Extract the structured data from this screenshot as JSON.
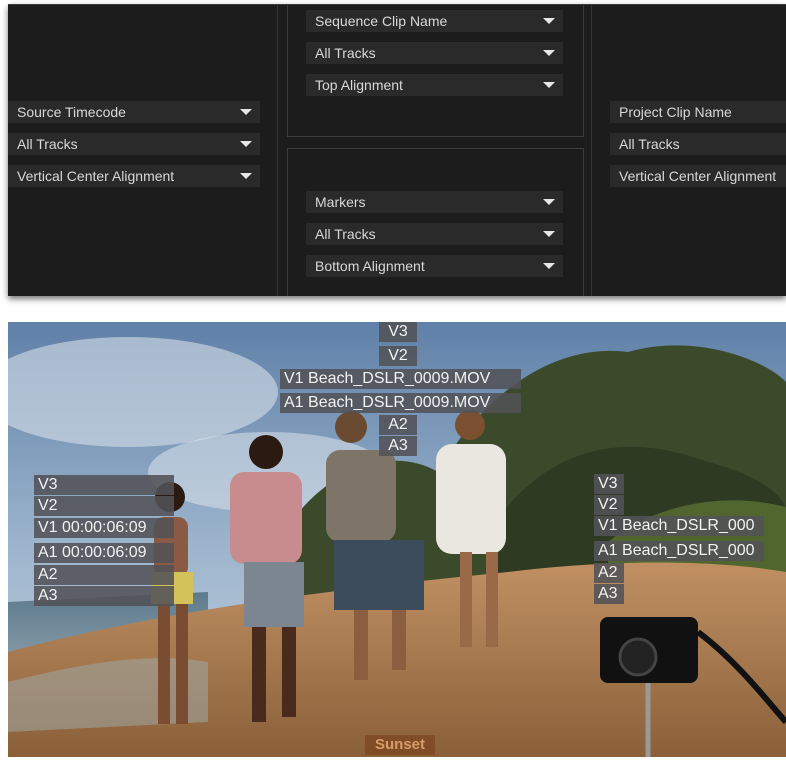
{
  "settings": {
    "left": {
      "content": "Source Timecode",
      "tracks": "All Tracks",
      "alignment": "Vertical Center Alignment"
    },
    "center_top": {
      "content": "Sequence Clip Name",
      "tracks": "All Tracks",
      "alignment": "Top Alignment"
    },
    "center_bottom": {
      "content": "Markers",
      "tracks": "All Tracks",
      "alignment": "Bottom Alignment"
    },
    "right": {
      "content": "Project Clip Name",
      "tracks": "All Tracks",
      "alignment": "Vertical Center Alignment"
    }
  },
  "overlays": {
    "top": [
      "V3",
      "V2",
      "V1 Beach_DSLR_0009.MOV",
      "A1 Beach_DSLR_0009.MOV",
      "A2",
      "A3"
    ],
    "left": [
      "V3",
      "V2",
      "V1 00:00:06:09",
      "A1 00:00:06:09",
      "A2",
      "A3"
    ],
    "right": [
      "V3",
      "V2",
      "V1 Beach_DSLR_000",
      "A1 Beach_DSLR_000",
      "A2",
      "A3"
    ],
    "marker": "Sunset"
  },
  "colors": {
    "panel_bg": "#1c1c1c",
    "dropdown_bg": "#2a2a2a",
    "overlay_bg": "#525256",
    "marker_bg": "#7e4a24"
  }
}
